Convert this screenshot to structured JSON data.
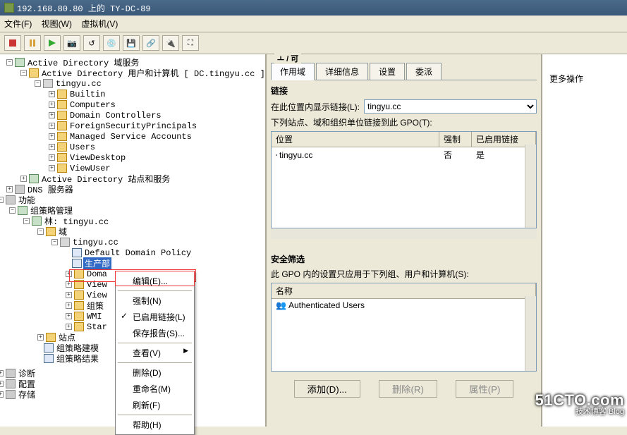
{
  "title": "192.168.80.80 上的 TY-DC-89",
  "menus": {
    "file": "文件(F)",
    "view": "视图(W)",
    "vm": "虚拟机(V)"
  },
  "tree": {
    "ad_domain_services": "Active Directory 域服务",
    "ad_users_computers": "Active Directory 用户和计算机 [ DC.tingyu.cc ]",
    "domain_root": "tingyu.cc",
    "builtin": "Builtin",
    "computers": "Computers",
    "domain_controllers": "Domain Controllers",
    "fsp": "ForeignSecurityPrincipals",
    "msa": "Managed Service Accounts",
    "users": "Users",
    "viewdesktop": "ViewDesktop",
    "viewuser": "ViewUser",
    "ad_sites_services": "Active Directory 站点和服务",
    "dns": "DNS 服务器",
    "features": "功能",
    "gpmc": "组策略管理",
    "forest": "林: tingyu.cc",
    "domains": "域",
    "default_policy": "Default Domain Policy",
    "prod_dept": "生产部",
    "domain_trunc": "Doma",
    "view1": "View",
    "view2": "View",
    "comp_trunc": "组策",
    "wmi_trunc": "WMI ",
    "star_trunc": "Star",
    "sites": "站点",
    "gp_modeling": "组策略建模",
    "gp_results": "组策略结果",
    "diagnostics": "诊断",
    "configuration": "配置",
    "storage": "存储"
  },
  "context_menu": {
    "edit": "编辑(E)...",
    "enforce": "强制(N)",
    "link_enabled": "已启用链接(L)",
    "save_report": "保存报告(S)...",
    "view_sub": "查看(V)",
    "delete": "删除(D)",
    "rename": "重命名(M)",
    "refresh": "刷新(F)",
    "help": "帮助(H)"
  },
  "legend_cut": "ㅗ /  可",
  "tabs": {
    "scope": "作用域",
    "details": "详细信息",
    "settings": "设置",
    "delegation": "委派"
  },
  "links": {
    "heading": "链接",
    "display_links_label": "在此位置内显示链接(L):",
    "domain_value": "tingyu.cc",
    "linked_label": "下列站点、域和组织单位链接到此 GPO(T):",
    "col_location": "位置",
    "col_enforced": "强制",
    "col_link_enabled": "已启用链接",
    "row_loc": "tingyu.cc",
    "row_enf": "否",
    "row_enabled": "是"
  },
  "security": {
    "heading": "安全筛选",
    "desc": "此 GPO 内的设置只应用于下列组、用户和计算机(S):",
    "col_name": "名称",
    "row_authusers": "Authenticated Users"
  },
  "buttons": {
    "add": "添加(D)...",
    "remove": "删除(R)",
    "props": "属性(P)"
  },
  "actions": {
    "more": "更多操作"
  },
  "watermark": {
    "line1": "51CTO.com",
    "line2": "技术博客      Blog"
  }
}
